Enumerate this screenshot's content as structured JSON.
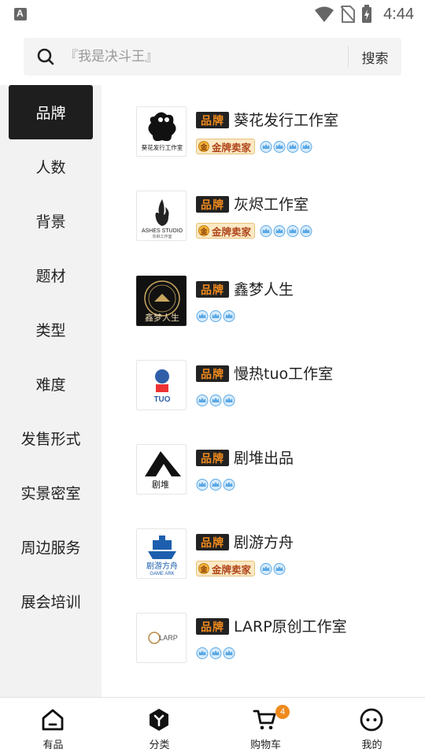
{
  "status_bar": {
    "time": "4:44",
    "app_icon_letter": "A"
  },
  "search": {
    "placeholder": "『我是决斗王』",
    "button_label": "搜索"
  },
  "sidebar": {
    "items": [
      {
        "label": "品牌",
        "active": true
      },
      {
        "label": "人数",
        "active": false
      },
      {
        "label": "背景",
        "active": false
      },
      {
        "label": "题材",
        "active": false
      },
      {
        "label": "类型",
        "active": false
      },
      {
        "label": "难度",
        "active": false
      },
      {
        "label": "发售形式",
        "active": false
      },
      {
        "label": "实景密室",
        "active": false
      },
      {
        "label": "周边服务",
        "active": false
      },
      {
        "label": "展会培训",
        "active": false
      }
    ]
  },
  "brand_tag": "品牌",
  "gold_seller_label": "金牌卖家",
  "brands": [
    {
      "name": "葵花发行工作室",
      "gold_seller": true,
      "crowns": 4,
      "logo_icon": "sunflower-studio-logo",
      "logo_text": "葵花发行工作室"
    },
    {
      "name": "灰烬工作室",
      "gold_seller": true,
      "crowns": 4,
      "logo_icon": "ashes-studio-logo",
      "logo_text": "ASHES STUDIO",
      "logo_subtext": "灰烬工作室"
    },
    {
      "name": "鑫梦人生",
      "gold_seller": false,
      "crowns": 3,
      "logo_icon": "xinmeng-logo",
      "logo_text": "鑫梦人生"
    },
    {
      "name": "慢热tuo工作室",
      "gold_seller": false,
      "crowns": 3,
      "logo_icon": "tuo-studio-logo",
      "logo_text": "TUO"
    },
    {
      "name": "剧堆出品",
      "gold_seller": false,
      "crowns": 3,
      "logo_icon": "judui-logo",
      "logo_text": "剧堆"
    },
    {
      "name": "剧游方舟",
      "gold_seller": true,
      "crowns": 2,
      "logo_icon": "game-ark-logo",
      "logo_text": "剧游方舟",
      "logo_subtext": "GAME ARK"
    },
    {
      "name": "LARP原创工作室",
      "gold_seller": false,
      "crowns": 3,
      "logo_icon": "larp-studio-logo",
      "logo_text": "LARP"
    }
  ],
  "bottom_nav": {
    "items": [
      {
        "label": "有品",
        "icon": "home-icon"
      },
      {
        "label": "分类",
        "icon": "category-icon"
      },
      {
        "label": "购物车",
        "icon": "cart-icon",
        "badge": "4"
      },
      {
        "label": "我的",
        "icon": "profile-icon"
      }
    ]
  },
  "colors": {
    "accent": "#f08a1c",
    "active_bg": "#1e1e1e",
    "sidebar_bg": "#f2f2f2",
    "crown": "#5aa8e6"
  }
}
